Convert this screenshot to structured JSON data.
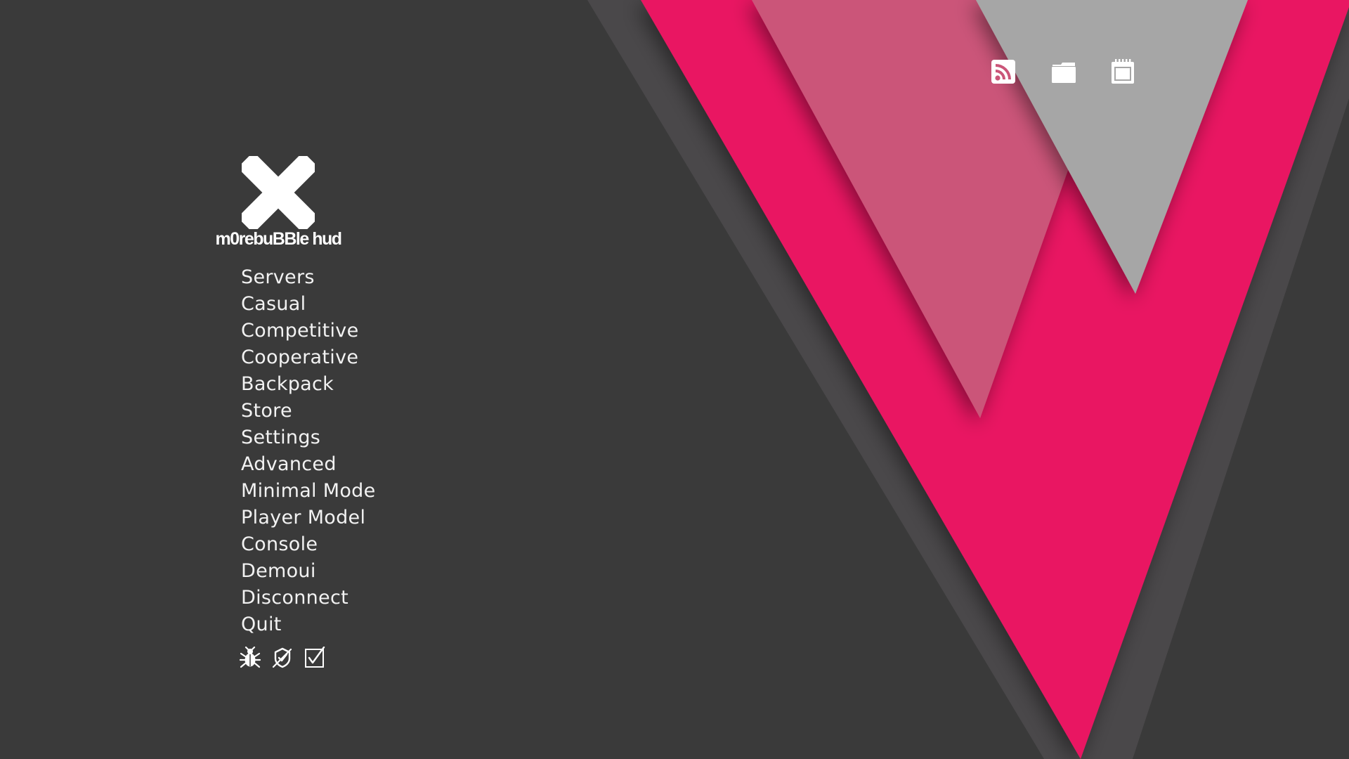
{
  "logo": {
    "title": "m0rebuBBle hud",
    "icon": "x-cross-icon"
  },
  "menu": {
    "items": [
      {
        "label": "Servers"
      },
      {
        "label": "Casual"
      },
      {
        "label": "Competitive"
      },
      {
        "label": "Cooperative"
      },
      {
        "label": "Backpack"
      },
      {
        "label": "Store"
      },
      {
        "label": "Settings"
      },
      {
        "label": "Advanced"
      },
      {
        "label": "Minimal Mode"
      },
      {
        "label": "Player Model"
      },
      {
        "label": "Console"
      },
      {
        "label": "Demoui"
      },
      {
        "label": "Disconnect"
      },
      {
        "label": "Quit"
      }
    ]
  },
  "top_icons": [
    "rss-icon",
    "folder-icon",
    "calendar-icon"
  ],
  "bottom_icons": [
    "bug-icon",
    "achievements-icon",
    "checkbox-icon"
  ],
  "colors": {
    "background": "#3a3a3a",
    "accent_pink": "#e91862",
    "pink_faded": "#cb5579",
    "gray_triangle": "#a6a6a6",
    "shadow_band": "#4a484a",
    "text": "#ffffff"
  }
}
